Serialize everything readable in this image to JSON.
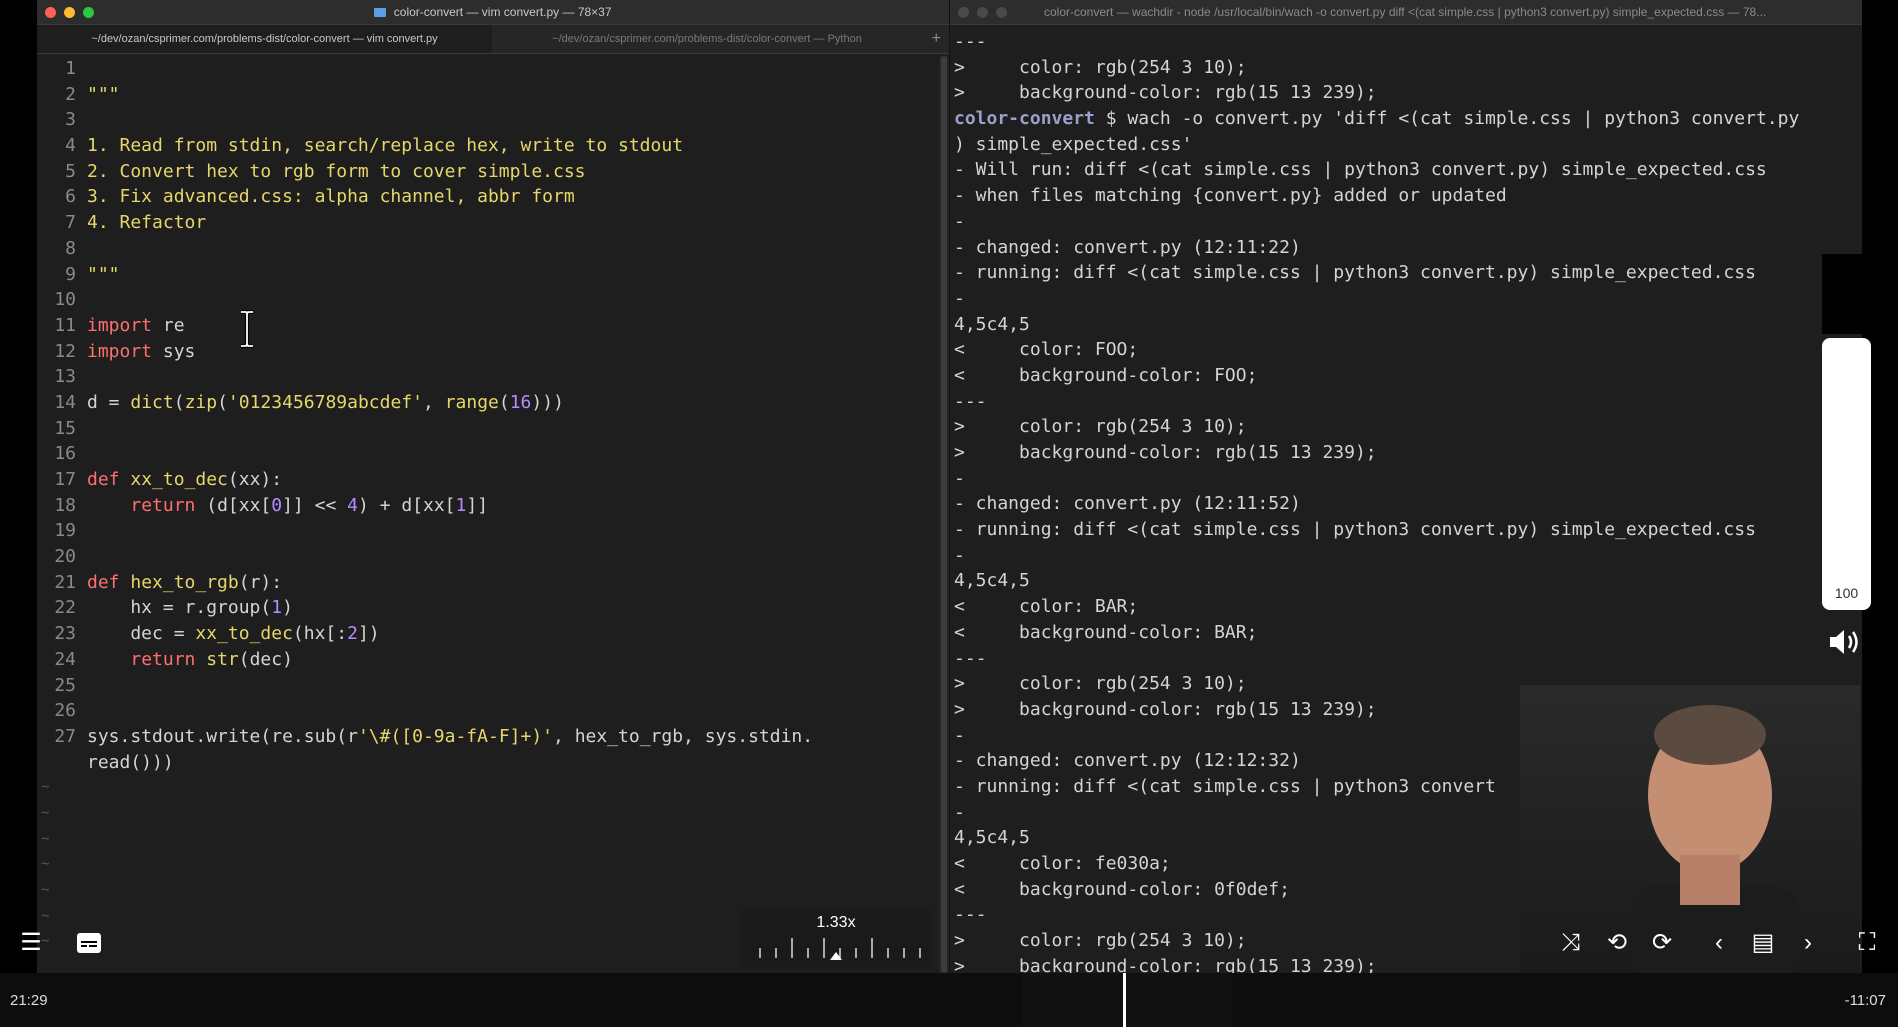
{
  "left_window": {
    "title": "color-convert — vim convert.py — 78×37",
    "tabs": [
      {
        "label": "~/dev/ozan/csprimer.com/problems-dist/color-convert — vim convert.py"
      },
      {
        "label": "~/dev/ozan/csprimer.com/problems-dist/color-convert — Python"
      }
    ],
    "plus": "+",
    "line_numbers": [
      "1",
      "2",
      "3",
      "4",
      "5",
      "6",
      "7",
      "8",
      "9",
      "10",
      "11",
      "12",
      "13",
      "14",
      "15",
      "16",
      "17",
      "18",
      "19",
      "20",
      "21",
      "22",
      "23",
      "24",
      "25",
      "26",
      "27"
    ],
    "code_lines": [
      "",
      "\"\"\"",
      "",
      "1. Read from stdin, search/replace hex, write to stdout",
      "2. Convert hex to rgb form to cover simple.css",
      "3. Fix advanced.css: alpha channel, abbr form",
      "4. Refactor",
      "",
      "\"\"\"",
      "",
      "import re",
      "import sys",
      "",
      "d = dict(zip('0123456789abcdef', range(16)))",
      "",
      "",
      "def xx_to_dec(xx):",
      "    return (d[xx[0]] << 4) + d[xx[1]]",
      "",
      "",
      "def hex_to_rgb(r):",
      "    hx = r.group(1)",
      "    dec = xx_to_dec(hx[:2])",
      "    return str(dec)",
      "",
      "",
      "sys.stdout.write(re.sub(r'\\#([0-9a-fA-F]+)', hex_to_rgb, sys.stdin."
    ],
    "wrap_line": "read()))",
    "tilde": "~"
  },
  "right_window": {
    "title": "color-convert — wachdir - node /usr/local/bin/wach -o convert.py diff <(cat simple.css | python3 convert.py) simple_expected.css — 78...",
    "lines": [
      "---",
      ">     color: rgb(254 3 10);",
      ">     background-color: rgb(15 13 239);",
      "color-convert $ wach -o convert.py 'diff <(cat simple.css | python3 convert.py",
      ") simple_expected.css'",
      "- Will run: diff <(cat simple.css | python3 convert.py) simple_expected.css",
      "- when files matching {convert.py} added or updated",
      "-",
      "- changed: convert.py (12:11:22)",
      "- running: diff <(cat simple.css | python3 convert.py) simple_expected.css",
      "-",
      "4,5c4,5",
      "<     color: FOO;",
      "<     background-color: FOO;",
      "---",
      ">     color: rgb(254 3 10);",
      ">     background-color: rgb(15 13 239);",
      "-",
      "- changed: convert.py (12:11:52)",
      "- running: diff <(cat simple.css | python3 convert.py) simple_expected.css",
      "-",
      "4,5c4,5",
      "<     color: BAR;",
      "<     background-color: BAR;",
      "---",
      ">     color: rgb(254 3 10);",
      ">     background-color: rgb(15 13 239);",
      "-",
      "- changed: convert.py (12:12:32)",
      "- running: diff <(cat simple.css | python3 convert",
      "-",
      "4,5c4,5",
      "<     color: fe030a;",
      "<     background-color: 0f0def;",
      "---",
      ">     color: rgb(254 3 10);",
      ">     background-color: rgb(15 13 239);"
    ]
  },
  "player": {
    "speed": "1.33x",
    "volume": "100",
    "time_elapsed": "21:29",
    "time_remaining": "-11:07"
  },
  "colors": {
    "keyword": "#ff6f6f",
    "function": "#e6d76a",
    "number": "#b48cff",
    "prompt": "#9aa0c8"
  }
}
